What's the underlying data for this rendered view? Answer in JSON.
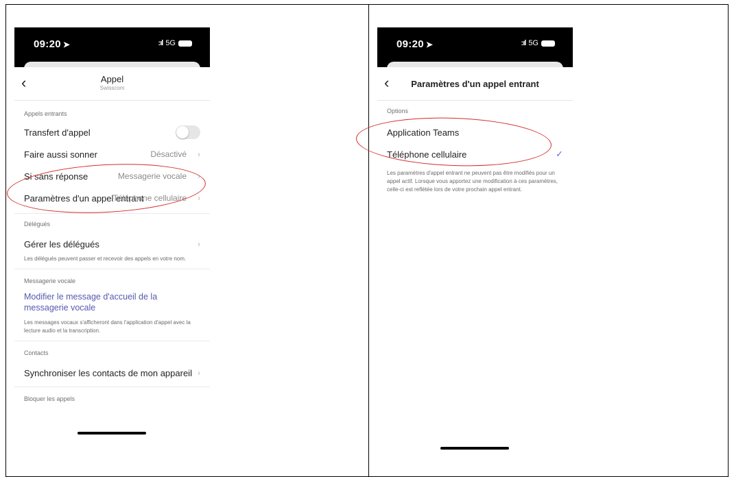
{
  "left": {
    "status": {
      "time": "09:20",
      "network": "5G"
    },
    "nav": {
      "title": "Appel",
      "subtitle": "Swisscom"
    },
    "incoming": {
      "section": "Appels entrants",
      "forwarding": "Transfert d'appel",
      "ring_also": {
        "label": "Faire aussi sonner",
        "value": "Désactivé"
      },
      "no_answer": {
        "label": "Si sans réponse",
        "value": "Messagerie vocale"
      },
      "incoming_settings": {
        "label": "Paramètres d'un appel entrant",
        "value": "Téléphone cellulaire"
      }
    },
    "delegates": {
      "section": "Délégués",
      "manage": "Gérer les délégués",
      "note": "Les délégués peuvent passer et recevoir des appels en votre nom."
    },
    "voicemail": {
      "section": "Messagerie vocale",
      "link": "Modifier le message d'accueil de la messagerie vocale",
      "note": "Les messages vocaux s'afficheront dans l'application d'appel avec la lecture audio et la transcription."
    },
    "contacts": {
      "section": "Contacts",
      "sync": "Synchroniser les contacts de mon appareil"
    },
    "block": {
      "section": "Bloquer les appels"
    }
  },
  "right": {
    "status": {
      "time": "09:20",
      "network": "5G"
    },
    "nav": {
      "title": "Paramètres d'un appel entrant"
    },
    "options": {
      "section": "Options",
      "teams": "Application Teams",
      "mobile": "Téléphone cellulaire"
    },
    "note": "Les paramètres d'appel entrant ne peuvent pas être modifiés pour un appel actif. Lorsque vous apportez une modification à ces paramètres, celle-ci est reflétée lors de votre prochain appel entrant."
  },
  "colors": {
    "accent": "#5559b0",
    "annotation": "#d62a2a",
    "check": "#5f6bd8"
  }
}
